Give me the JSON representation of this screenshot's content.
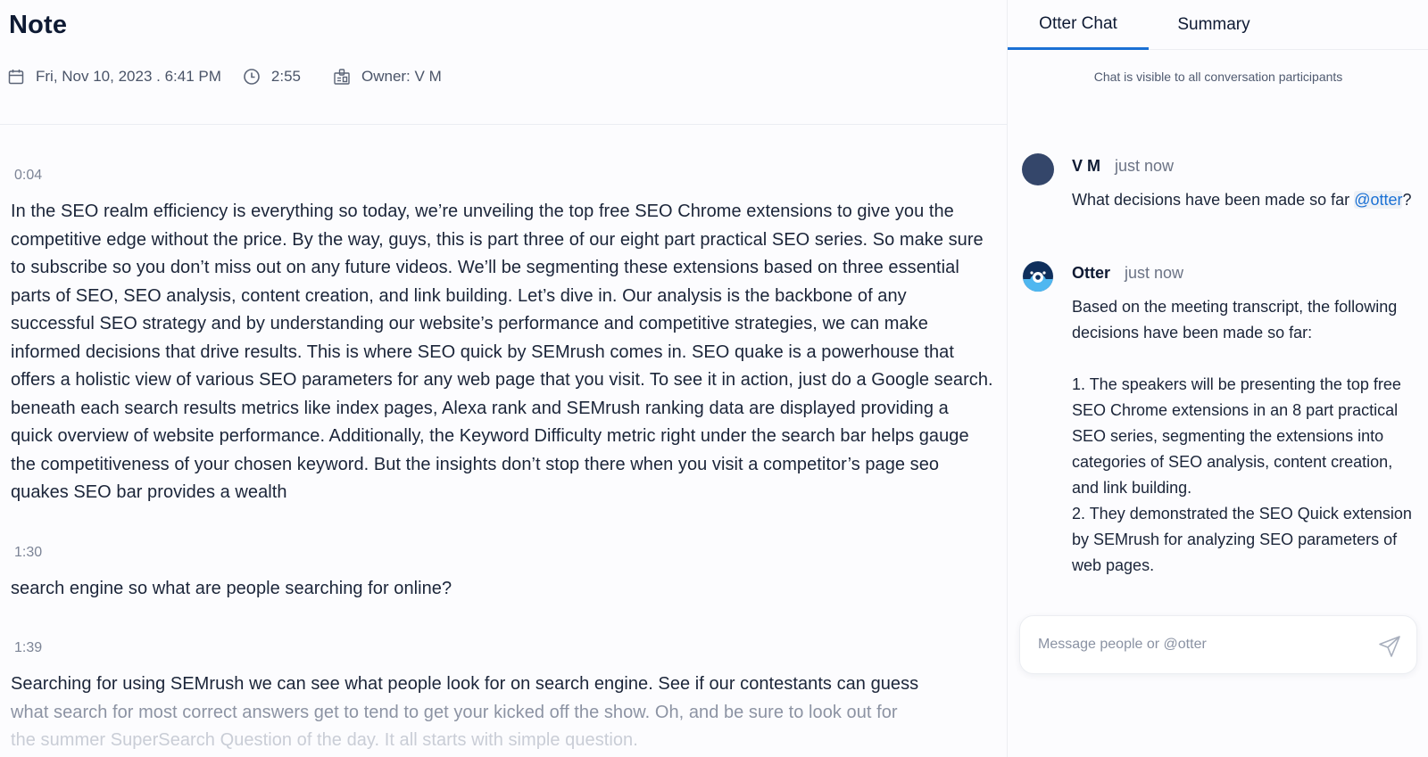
{
  "note": {
    "title": "Note",
    "meta": {
      "date_icon": "calendar-icon",
      "date": "Fri, Nov 10, 2023 . 6:41 PM",
      "duration_icon": "clock-icon",
      "duration": "2:55",
      "owner_icon": "id-badge-icon",
      "owner": "Owner: V M"
    }
  },
  "transcript": [
    {
      "timestamp": "0:04",
      "text": "In the SEO realm efficiency is everything so today, we’re unveiling the top free SEO Chrome extensions to give you the competitive edge without the price. By the way, guys, this is part three of our eight part practical SEO series. So make sure to subscribe so you don’t miss out on any future videos. We’ll be segmenting these extensions based on three essential parts of SEO, SEO analysis, content creation, and link building. Let’s dive in. Our analysis is the backbone of any successful SEO strategy and by understanding our website’s performance and competitive strategies, we can make informed decisions that drive results. This is where SEO quick by SEMrush comes in. SEO quake is a powerhouse that offers a holistic view of various SEO parameters for any web page that you visit. To see it in action, just do a Google search. beneath each search results metrics like index pages, Alexa rank and SEMrush ranking data are displayed providing a quick overview of website performance. Additionally, the Keyword Difficulty metric right under the search bar helps gauge the competitiveness of your chosen keyword. But the insights don’t stop there when you visit a competitor’s page seo quakes SEO bar provides a wealth"
    },
    {
      "timestamp": "1:30",
      "text": "search engine so what are people searching for online?"
    },
    {
      "timestamp": "1:39",
      "lines": [
        "Searching for using SEMrush we can see what people look for on search engine. See if our contestants can guess",
        "what search for most correct answers get to tend to get your kicked off the show. Oh, and be sure to look out for",
        "the summer SuperSearch Question of the day. It all starts with simple question."
      ]
    }
  ],
  "chat_panel": {
    "tabs": [
      {
        "label": "Otter Chat",
        "active": true
      },
      {
        "label": "Summary",
        "active": false
      }
    ],
    "visibility_notice": "Chat is visible to all conversation participants",
    "messages": [
      {
        "author": "V M",
        "time": "just now",
        "text_before": "What decisions have been made so far ",
        "mention": "@otter",
        "text_after": "?"
      },
      {
        "author": "Otter",
        "time": "just now",
        "intro": "Based on the meeting transcript, the following decisions have been made so far:",
        "items": [
          "1. The speakers will be presenting the top free SEO Chrome extensions in an 8 part practical SEO series, segmenting the extensions into categories of SEO analysis, content creation, and link building.",
          "2. They demonstrated the SEO Quick extension by SEMrush for analyzing SEO parameters of web pages."
        ]
      }
    ],
    "composer": {
      "placeholder": "Message people or @otter",
      "value": "",
      "send_icon": "send-icon"
    }
  },
  "colors": {
    "accent": "#1a70d4",
    "text": "#1b2539",
    "muted": "#7c8496",
    "avatar_vm": "#34466a",
    "otter_dark": "#0f2f5c",
    "otter_light": "#4fb7f0"
  }
}
